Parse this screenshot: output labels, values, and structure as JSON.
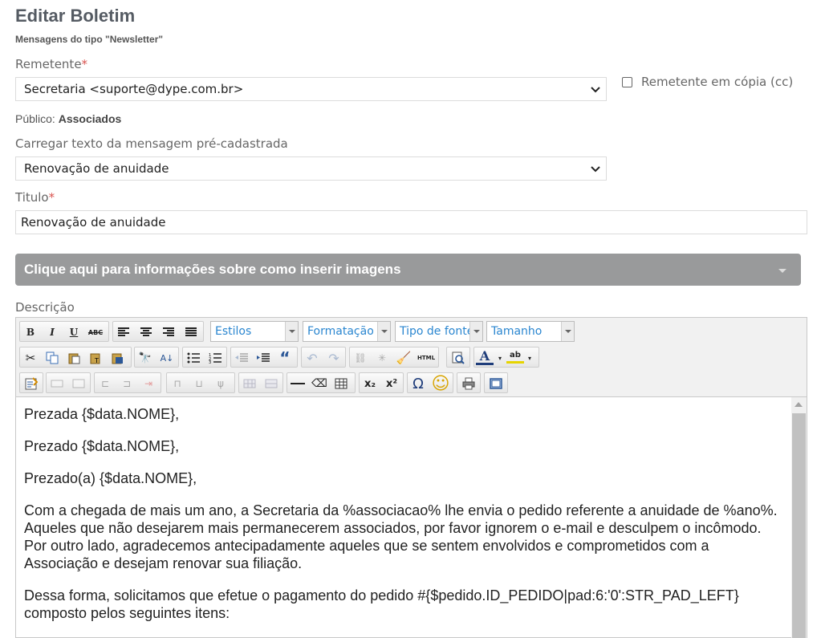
{
  "page": {
    "title": "Editar Boletim",
    "subtitle": "Mensagens do tipo \"Newsletter\""
  },
  "form": {
    "remetente_label": "Remetente",
    "required_mark": "*",
    "remetente_value": "Secretaria <suporte@dype.com.br>",
    "cc_label": "Remetente em cópia (cc)",
    "cc_checked": false,
    "publico_label": "Público:",
    "publico_value": "Associados",
    "carregar_label": "Carregar texto da mensagem pré-cadastrada",
    "carregar_value": "Renovação de anuidade",
    "titulo_label": "Titulo",
    "titulo_value": "Renovação de anuidade",
    "info_bar_text": "Clique aqui para informações sobre como inserir imagens",
    "descricao_label": "Descrição"
  },
  "toolbar": {
    "combos": {
      "estilos": "Estilos",
      "formatacao": "Formatação",
      "tipo_fonte": "Tipo de fonte",
      "tamanho": "Tamanho"
    },
    "glyphs": {
      "bold": "B",
      "italic": "I",
      "underline": "U",
      "strike": "ABC",
      "html": "HTML",
      "omega": "Ω",
      "smiley": "☺",
      "font_color": "A",
      "bg_color": "ab",
      "sub": "x₂",
      "sup": "x²",
      "blockquote": "“"
    }
  },
  "editor": {
    "paragraphs": [
      "Prezada {$data.NOME},",
      "Prezado {$data.NOME},",
      "Prezado(a) {$data.NOME},",
      "Com a chegada de mais um ano, a Secretaria da %associacao% lhe envia o pedido referente a anuidade de %ano%. Aqueles que não desejarem mais permanecerem associados, por favor ignorem o e-mail e desculpem o incômodo. Por outro lado, agradecemos antecipadamente aqueles que se sentem envolvidos e comprometidos com a Associação e desejam renovar sua filiação.",
      "Dessa forma, solicitamos que efetue o pagamento do pedido #{$pedido.ID_PEDIDO|pad:6:'0':STR_PAD_LEFT} composto pelos seguintes itens:"
    ]
  }
}
